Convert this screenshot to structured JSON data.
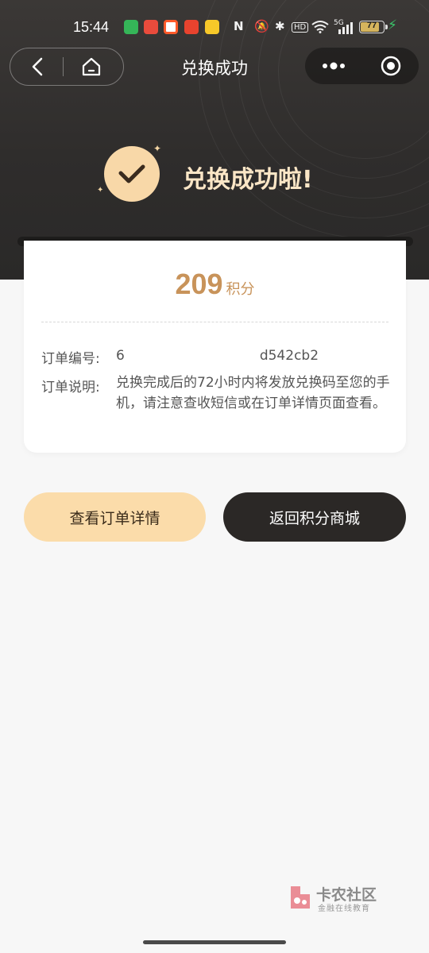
{
  "status_bar": {
    "time": "15:44",
    "battery": "77",
    "battery_level": 0.77,
    "network": "5G",
    "hd": "HD"
  },
  "nav": {
    "title": "兑换成功"
  },
  "success": {
    "message": "兑换成功啦!"
  },
  "card": {
    "points_value": "209",
    "points_unit": "积分",
    "order_no_label": "订单编号:",
    "order_no_value": "6",
    "order_no_value_end": "d542cb2",
    "order_desc_label": "订单说明:",
    "order_desc_value": "兑换完成后的72小时内将发放兑换码至您的手机，请注意查收短信或在订单详情页面查看。"
  },
  "buttons": {
    "view_order": "查看订单详情",
    "back_to_mall": "返回积分商城"
  },
  "watermark": {
    "title": "卡农社区",
    "subtitle": "金融在线教育"
  },
  "colors": {
    "header_bg": "#2f2d2c",
    "accent_gold": "#c8935a",
    "button_light": "#fbdcaa",
    "button_dark": "#2b2826",
    "badge": "#f8d8a8"
  }
}
